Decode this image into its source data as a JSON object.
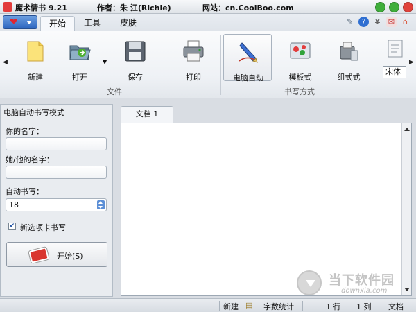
{
  "titlebar": {
    "app_name": "魔术情书 9.21",
    "author": "作者：朱 江(Richie)",
    "website": "网站：cn.CoolBoo.com"
  },
  "tabs": [
    {
      "label": "开始",
      "active": true
    },
    {
      "label": "工具",
      "active": false
    },
    {
      "label": "皮肤",
      "active": false
    }
  ],
  "ribbon": {
    "file_group_label": "文件",
    "writing_group_label": "书写方式",
    "buttons": {
      "new": "新建",
      "open": "打开",
      "save": "保存",
      "print": "打印",
      "auto_write": "电脑自动",
      "template": "模板式",
      "combined": "组式式"
    },
    "font_name": "宋体"
  },
  "left_panel": {
    "title": "电脑自动书写模式",
    "your_name_label": "你的名字：",
    "your_name_value": "",
    "their_name_label": "她/他的名字：",
    "their_name_value": "",
    "auto_write_label": "自动书写：",
    "auto_write_value": "18",
    "new_tab_checkbox_label": "新选项卡书写",
    "new_tab_checked": true,
    "start_button_label": "开始(S)"
  },
  "document": {
    "tab_label": "文档 1",
    "content": ""
  },
  "watermark": {
    "text": "当下软件园",
    "url": "downxia.com"
  },
  "statusbar": {
    "new": "新建",
    "word_count": "字数统计",
    "row": "1 行",
    "col": "1 列",
    "mode": "文档"
  },
  "colors": {
    "accent": "#2d66c0",
    "window_close": "#e0423b",
    "window_max": "#3fae3b",
    "window_min": "#3fae3b"
  }
}
